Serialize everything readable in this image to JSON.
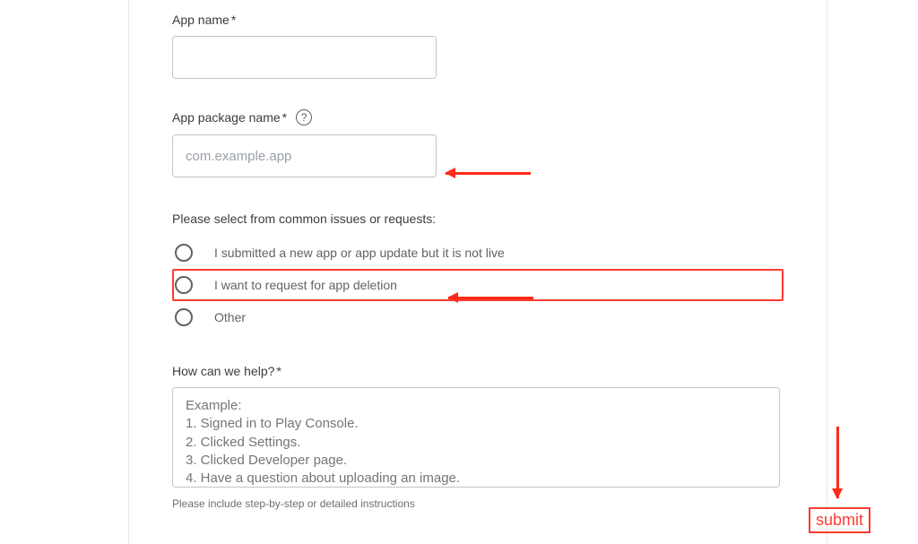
{
  "fields": {
    "app_name": {
      "label": "App name",
      "required": "*"
    },
    "app_package": {
      "label": "App package name",
      "required": "*",
      "placeholder": "com.example.app"
    },
    "issue_prompt": "Please select from common issues or requests:",
    "radios": [
      {
        "label": "I submitted a new app or app update but it is not live",
        "highlight": false
      },
      {
        "label": "I want to request for app deletion",
        "highlight": true
      },
      {
        "label": "Other",
        "highlight": false
      }
    ],
    "help": {
      "label": "How can we help?",
      "required": "*",
      "placeholder": "Example:\n1. Signed in to Play Console.\n2. Clicked Settings.\n3. Clicked Developer page.\n4. Have a question about uploading an image.",
      "hint": "Please include step-by-step or detailed instructions"
    }
  },
  "annotations": {
    "submit_label": "submit"
  }
}
